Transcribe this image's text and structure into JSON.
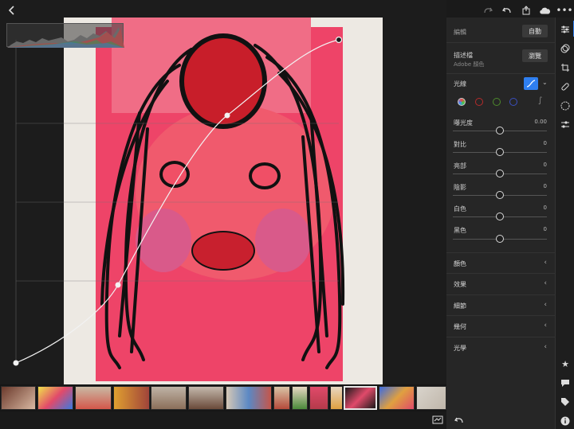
{
  "topbar": {
    "icons": [
      "back-icon",
      "redo-icon",
      "undo-icon",
      "share-icon",
      "cloud-sync-icon",
      "more-icon"
    ]
  },
  "panel": {
    "edit_label": "編輯",
    "auto_button": "自動",
    "profile_label": "描述檔",
    "profile_value": "Adobe 顏色",
    "browse_button": "瀏覽",
    "curve_label": "光線",
    "sliders": [
      {
        "label": "曝光度",
        "value": "0.00",
        "level": 0.5
      },
      {
        "label": "對比",
        "value": "0",
        "level": 0.5
      },
      {
        "label": "亮部",
        "value": "0",
        "level": 0.5
      },
      {
        "label": "陰影",
        "value": "0",
        "level": 0.5
      },
      {
        "label": "白色",
        "value": "0",
        "level": 0.5
      },
      {
        "label": "黑色",
        "value": "0",
        "level": 0.5
      }
    ],
    "sections": [
      "顏色",
      "效果",
      "細節",
      "幾何",
      "光學"
    ]
  },
  "curve_channels": [
    "rgb",
    "red",
    "green",
    "blue"
  ],
  "colors": {
    "accent": "#2f7ff0",
    "paper": "#ee4468",
    "panel": "#262626"
  },
  "filmstrip": {
    "count": 16,
    "selected_index": 10
  }
}
